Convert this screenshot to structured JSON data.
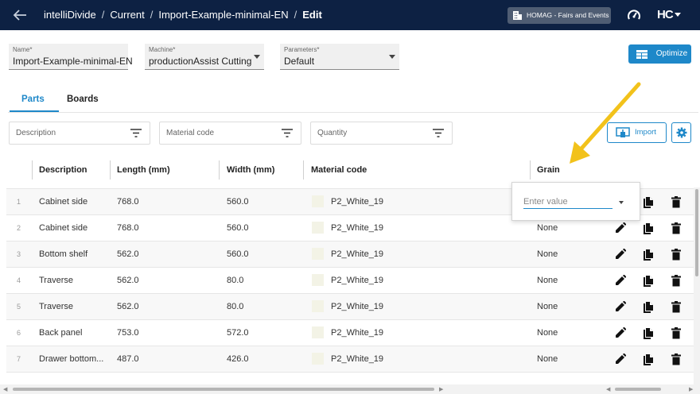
{
  "header": {
    "breadcrumb": [
      "intelliDivide",
      "Current",
      "Import-Example-minimal-EN",
      "Edit"
    ],
    "organization": "HOMAG - Fairs and Events",
    "logo": "HC"
  },
  "form": {
    "name": {
      "label": "Name*",
      "value": "Import-Example-minimal-EN"
    },
    "machine": {
      "label": "Machine*",
      "value": "productionAssist Cutting"
    },
    "parameters": {
      "label": "Parameters*",
      "value": "Default"
    },
    "optimize_label": "Optimize"
  },
  "tabs": [
    {
      "label": "Parts",
      "active": true
    },
    {
      "label": "Boards",
      "active": false
    }
  ],
  "filters": {
    "description": "Description",
    "material_code": "Material code",
    "quantity": "Quantity",
    "import_label": "Import"
  },
  "table": {
    "columns": [
      "Description",
      "Length (mm)",
      "Width (mm)",
      "Material code",
      "Grain"
    ],
    "rows": [
      {
        "num": "1",
        "description": "Cabinet side",
        "length": "768.0",
        "width": "560.0",
        "material": "P2_White_19",
        "grain": ""
      },
      {
        "num": "2",
        "description": "Cabinet side",
        "length": "768.0",
        "width": "560.0",
        "material": "P2_White_19",
        "grain": "None"
      },
      {
        "num": "3",
        "description": "Bottom shelf",
        "length": "562.0",
        "width": "560.0",
        "material": "P2_White_19",
        "grain": "None"
      },
      {
        "num": "4",
        "description": "Traverse",
        "length": "562.0",
        "width": "80.0",
        "material": "P2_White_19",
        "grain": "None"
      },
      {
        "num": "5",
        "description": "Traverse",
        "length": "562.0",
        "width": "80.0",
        "material": "P2_White_19",
        "grain": "None"
      },
      {
        "num": "6",
        "description": "Back panel",
        "length": "753.0",
        "width": "572.0",
        "material": "P2_White_19",
        "grain": "None"
      },
      {
        "num": "7",
        "description": "Drawer bottom...",
        "length": "487.0",
        "width": "426.0",
        "material": "P2_White_19",
        "grain": "None"
      }
    ]
  },
  "grain_editor": {
    "placeholder": "Enter value"
  },
  "colors": {
    "header_bg": "#0d2143",
    "accent": "#1e88c9",
    "annotation_arrow": "#f2c21b"
  }
}
